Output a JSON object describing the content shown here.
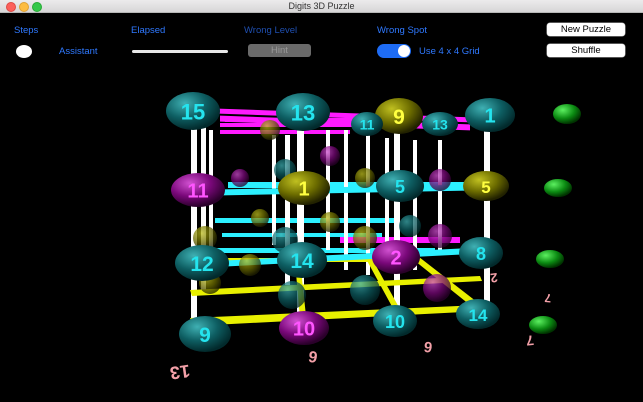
{
  "window": {
    "title": "Digits 3D Puzzle"
  },
  "controls": {
    "steps_label": "Steps",
    "elapsed_label": "Elapsed",
    "wrong_level_label": "Wrong Level",
    "wrong_spot_label": "Wrong Spot",
    "assistant_label": "Assistant",
    "hint_button": "Hint",
    "use_grid_label": "Use  4 x 4 Grid",
    "new_puzzle_button": "New Puzzle",
    "shuffle_button": "Shuffle"
  },
  "scene": {
    "colors": {
      "teal": "#0e5f63",
      "purple": "#8a0a8a",
      "olive": "#7a7a00",
      "green": "#0d9e16",
      "yellow": "#e8f000",
      "cyan": "#2cf0ff",
      "magenta": "#ff1aff",
      "white": "#ffffff",
      "pink": "#f3a0a8"
    },
    "balls": [
      {
        "label": "15",
        "color": "teal"
      },
      {
        "label": "13",
        "color": "teal"
      },
      {
        "label": "9",
        "color": "olive"
      },
      {
        "label": "1",
        "color": "teal"
      },
      {
        "label": "11",
        "color": "teal"
      },
      {
        "label": "13",
        "color": "teal"
      },
      {
        "label": "11",
        "color": "purple"
      },
      {
        "label": "1",
        "color": "olive"
      },
      {
        "label": "5",
        "color": "teal"
      },
      {
        "label": "5",
        "color": "olive"
      },
      {
        "label": "12",
        "color": "teal"
      },
      {
        "label": "14",
        "color": "teal"
      },
      {
        "label": "2",
        "color": "purple"
      },
      {
        "label": "8",
        "color": "teal"
      },
      {
        "label": "9",
        "color": "teal"
      },
      {
        "label": "10",
        "color": "purple"
      },
      {
        "label": "10",
        "color": "teal"
      },
      {
        "label": "14",
        "color": "teal"
      }
    ],
    "floating_digits": [
      "13",
      "6",
      "6",
      "7",
      "2",
      "7"
    ]
  }
}
